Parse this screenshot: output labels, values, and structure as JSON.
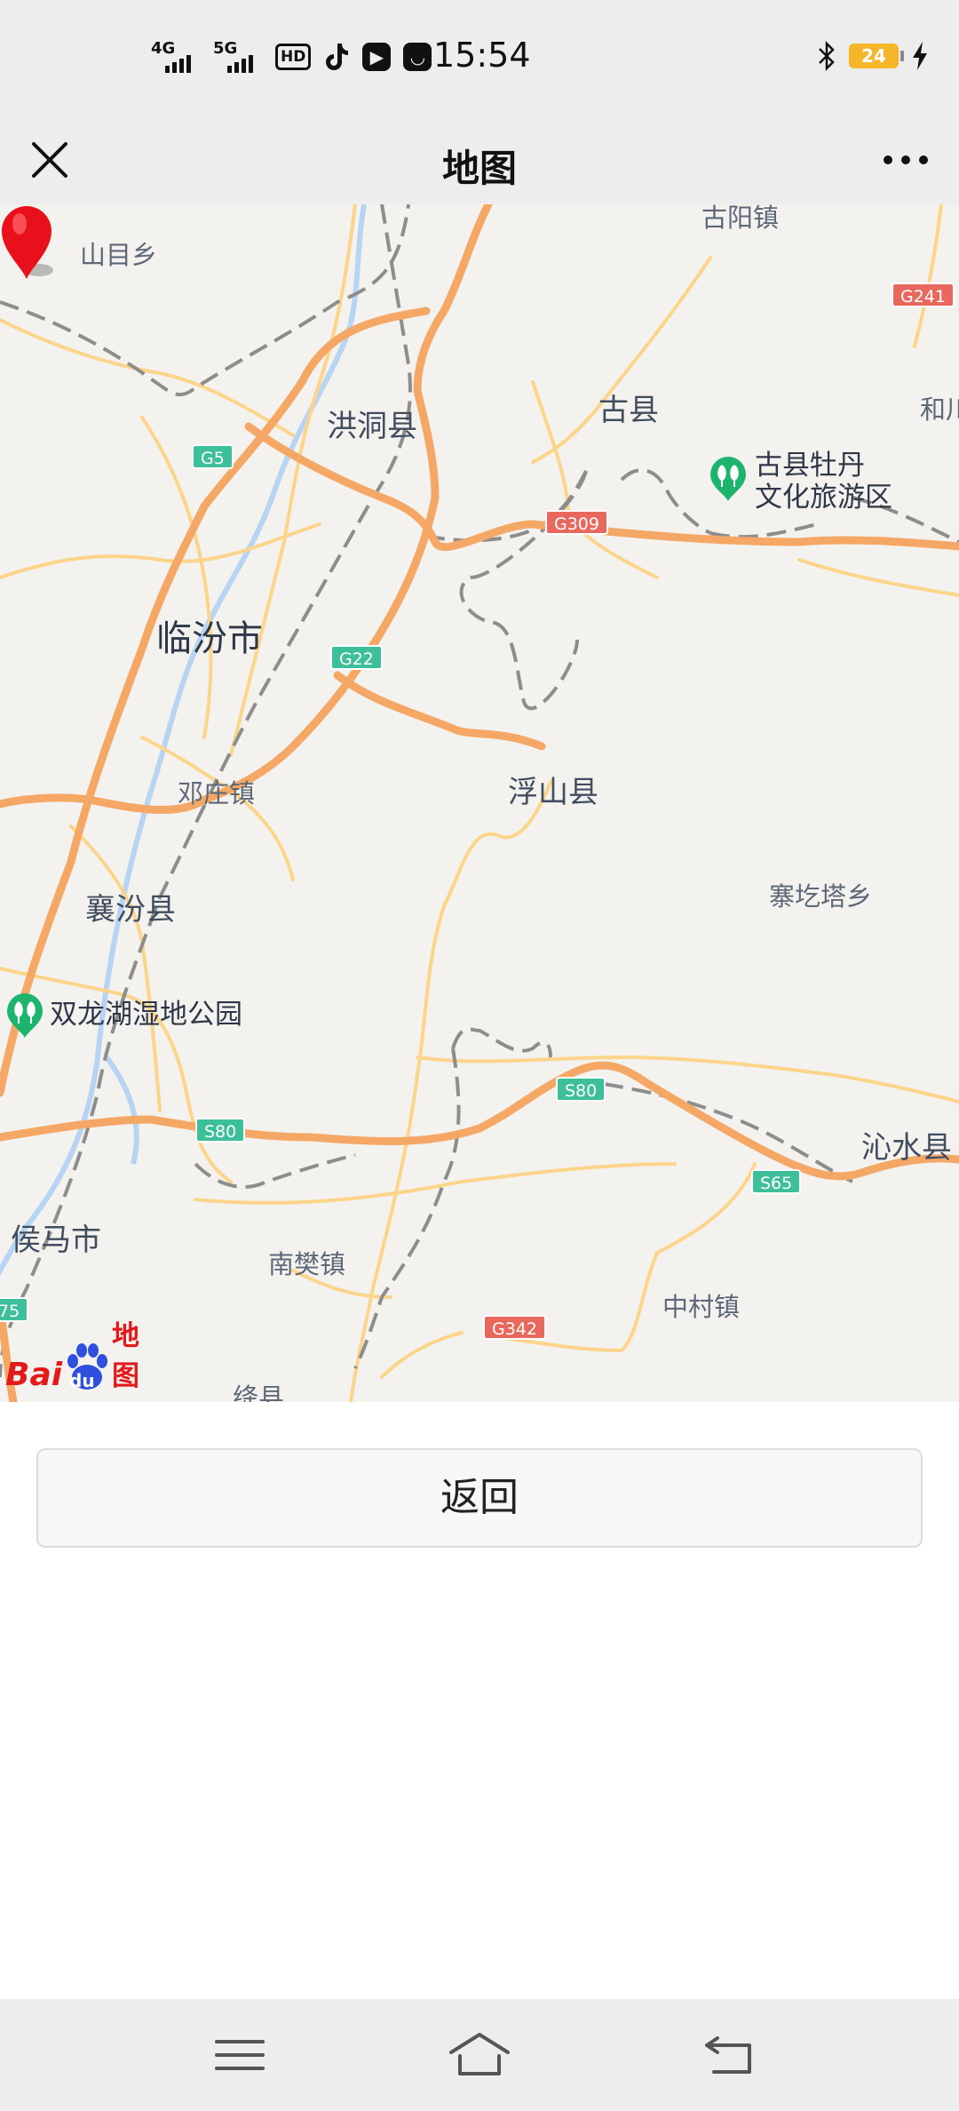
{
  "status_bar": {
    "signal_1": "4G",
    "signal_2": "5G",
    "hd_badge": "HD",
    "time": "15:54",
    "battery_level": "24",
    "icons": [
      "tiktok-icon",
      "video-icon",
      "mail-icon",
      "bluetooth-icon",
      "charging-icon"
    ]
  },
  "header": {
    "title": "地图",
    "close_icon": "close-icon",
    "more_icon": "more-icon"
  },
  "map": {
    "provider_logo": {
      "part1": "Bai",
      "part2": "du",
      "part3": "地图"
    },
    "places": {
      "shanmu": "山目乡",
      "guyang": "古阳镇",
      "hongdong": "洪洞县",
      "guxian": "古县",
      "he": "和川",
      "linfen": "临汾市",
      "dengzhuang": "邓庄镇",
      "fushan": "浮山县",
      "saigeta": "寨圪塔乡",
      "xiangfen": "襄汾县",
      "qinshui": "沁水县",
      "houma": "侯马市",
      "nanfan": "南樊镇",
      "zhongcun": "中村镇",
      "jiangxian": "绛县"
    },
    "poi": {
      "mudan_line1": "古县牡丹",
      "mudan_line2": "文化旅游区",
      "shuanglong": "双龙湖湿地公园"
    },
    "road_shields": {
      "g241": "G241",
      "g5": "G5",
      "g309": "G309",
      "g22": "G22",
      "s80_west": "S80",
      "s80_east": "S80",
      "s65": "S65",
      "g342": "G342",
      "s75_partial": "75"
    },
    "colors": {
      "land": "#f3f2ef",
      "highway": "#f5a866",
      "road": "#fcd58a",
      "railway": "#8d8d8d",
      "water": "#b7d5f2",
      "marker": "#e8101a",
      "poi_green": "#1db56e"
    }
  },
  "actions": {
    "back_label": "返回"
  },
  "system_nav": {
    "icons": [
      "menu-icon",
      "home-icon",
      "back-icon"
    ]
  }
}
